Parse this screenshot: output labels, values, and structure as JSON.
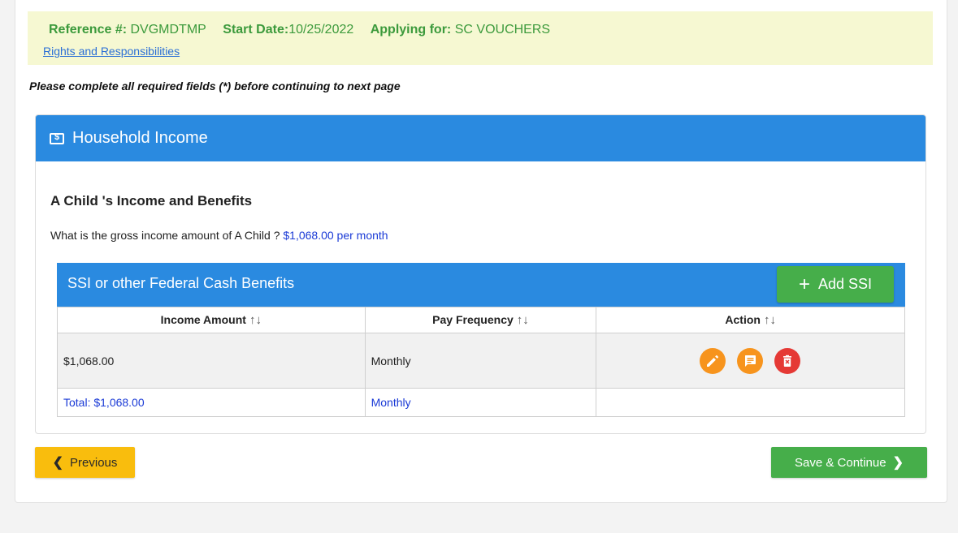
{
  "reference": {
    "ref_label": "Reference #:",
    "ref_value": "DVGMDTMP",
    "start_label": "Start Date:",
    "start_value": "10/25/2022",
    "applying_label": "Applying for:",
    "applying_value": "SC VOUCHERS",
    "rights_link": "Rights and Responsibilities"
  },
  "instructions": "Please complete all required fields (*) before continuing to next page",
  "panel": {
    "title": "Household Income",
    "icon": "money-icon",
    "section_title": "A Child 's Income and Benefits",
    "question": "What is the gross income amount of A Child ?",
    "question_amount": "$1,068.00 per month"
  },
  "ssi": {
    "title": "SSI or other Federal Cash Benefits",
    "add_button": "Add SSI",
    "columns": [
      "Income Amount",
      "Pay Frequency",
      "Action"
    ],
    "sort_glyph": "↑↓",
    "rows": [
      {
        "amount": "$1,068.00",
        "frequency": "Monthly"
      }
    ],
    "total": {
      "amount": "Total: $1,068.00",
      "frequency": "Monthly"
    },
    "actions": [
      "edit-icon",
      "comment-icon",
      "delete-icon"
    ]
  },
  "nav": {
    "previous": "Previous",
    "save_continue": "Save & Continue"
  },
  "colors": {
    "header_blue": "#2a8ae0",
    "green": "#46ae4a",
    "yellow": "#f9bd0d",
    "edit_orange": "#f7941d",
    "delete_red": "#e53935"
  }
}
